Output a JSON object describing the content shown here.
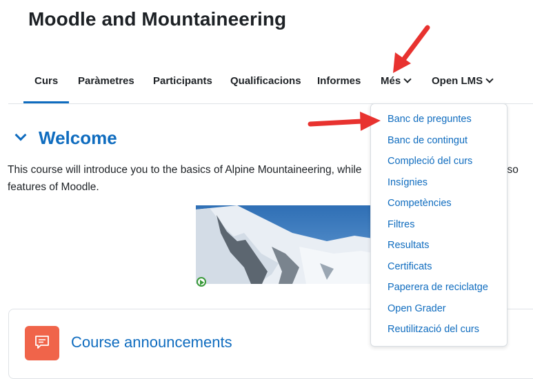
{
  "page": {
    "title": "Moodle and Mountaineering"
  },
  "nav": {
    "items": [
      {
        "label": "Curs",
        "active": true
      },
      {
        "label": "Paràmetres"
      },
      {
        "label": "Participants"
      },
      {
        "label": "Qualificacions"
      },
      {
        "label": "Informes"
      },
      {
        "label": "Més",
        "dropdown": true
      },
      {
        "label": "Open LMS",
        "dropdown": true
      }
    ]
  },
  "dropdown": {
    "items": [
      "Banc de preguntes",
      "Banc de contingut",
      "Compleció del curs",
      "Insígnies",
      "Competències",
      "Filtres",
      "Resultats",
      "Certificats",
      "Paperera de reciclatge",
      "Open Grader",
      "Reutilització del curs"
    ]
  },
  "section": {
    "title": "Welcome",
    "summary_line1": "This course will introduce you to the basics of Alpine Mountaineering, while",
    "summary_line1_tail": "ing so",
    "summary_line2": "features of Moodle."
  },
  "activity": {
    "title": "Course announcements",
    "icon": "forum-icon"
  },
  "colors": {
    "accent": "#0f6cbf",
    "arrow": "#e8322f",
    "forum_icon_bg": "#f0644a"
  }
}
